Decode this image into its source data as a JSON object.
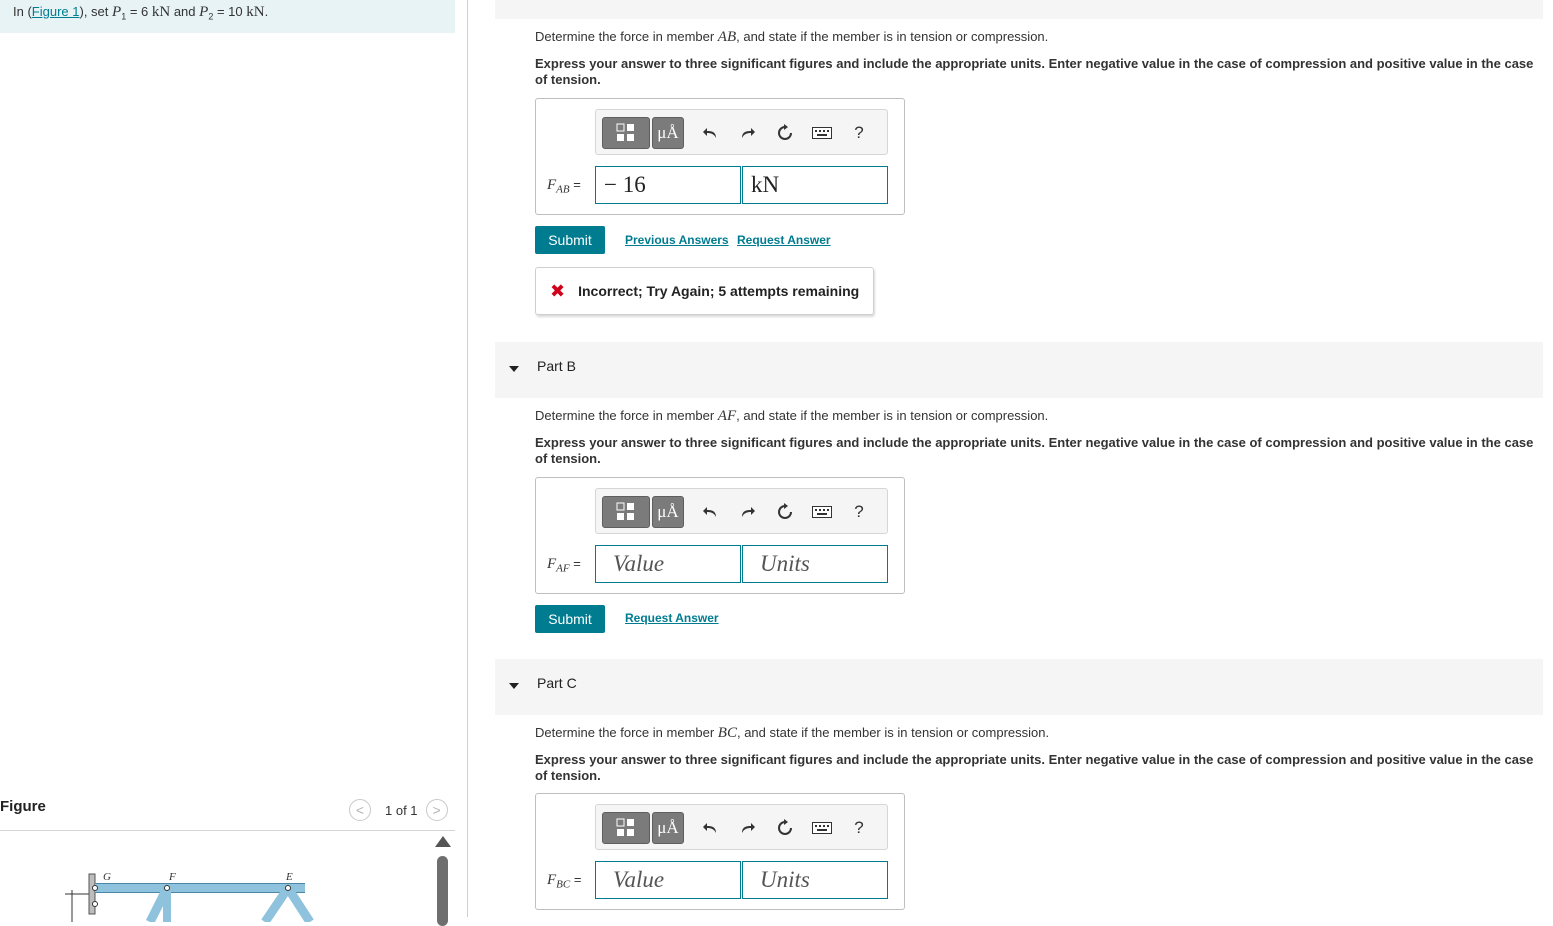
{
  "intro": {
    "prefix": "In (",
    "figure_link": "Figure 1",
    "middle": "), set ",
    "p1_var": "P",
    "p1_sub": "1",
    "p1_value": " = 6 ",
    "p1_unit": "kN",
    "and": " and ",
    "p2_var": "P",
    "p2_sub": "2",
    "p2_value": " = 10 ",
    "p2_unit": "kN",
    "suffix": "."
  },
  "figure": {
    "label": "Figure",
    "prev_icon": "<",
    "next_icon": ">",
    "count": "1 of 1",
    "node_labels": [
      "G",
      "F",
      "E"
    ]
  },
  "instructions": "Express your answer to three significant figures and include the appropriate units. Enter negative value in the case of compression and positive value in the case of tension.",
  "toolbar": {
    "units_button": "μÅ",
    "help": "?",
    "icons": [
      "templates-icon",
      "units-icon",
      "undo-icon",
      "redo-icon",
      "reset-icon",
      "keyboard-icon",
      "help-icon"
    ]
  },
  "submit_label": "Submit",
  "part_a": {
    "question_prefix": "Determine the force in member ",
    "member": "AB",
    "question_suffix": ", and state if the member is in tension or compression.",
    "var": "F",
    "var_sub": "AB",
    "eq": " =",
    "value": "− 16",
    "unit": "kN",
    "links": [
      "Previous Answers",
      "Request Answer"
    ],
    "feedback": "Incorrect; Try Again; 5 attempts remaining"
  },
  "part_b": {
    "title": "Part B",
    "question_prefix": "Determine the force in member ",
    "member": "AF",
    "question_suffix": ", and state if the member is in tension or compression.",
    "var": "F",
    "var_sub": "AF",
    "eq": " =",
    "value_placeholder": "Value",
    "unit_placeholder": "Units",
    "link": "Request Answer"
  },
  "part_c": {
    "title": "Part C",
    "question_prefix": "Determine the force in member ",
    "member": "BC",
    "question_suffix": ", and state if the member is in tension or compression.",
    "var": "F",
    "var_sub": "BC",
    "eq": " =",
    "value_placeholder": "Value",
    "unit_placeholder": "Units"
  },
  "colors": {
    "accent": "#007c91",
    "intro_bg": "#e8f3f6",
    "error": "#d0021b",
    "truss_member": "#8fc3dd"
  }
}
